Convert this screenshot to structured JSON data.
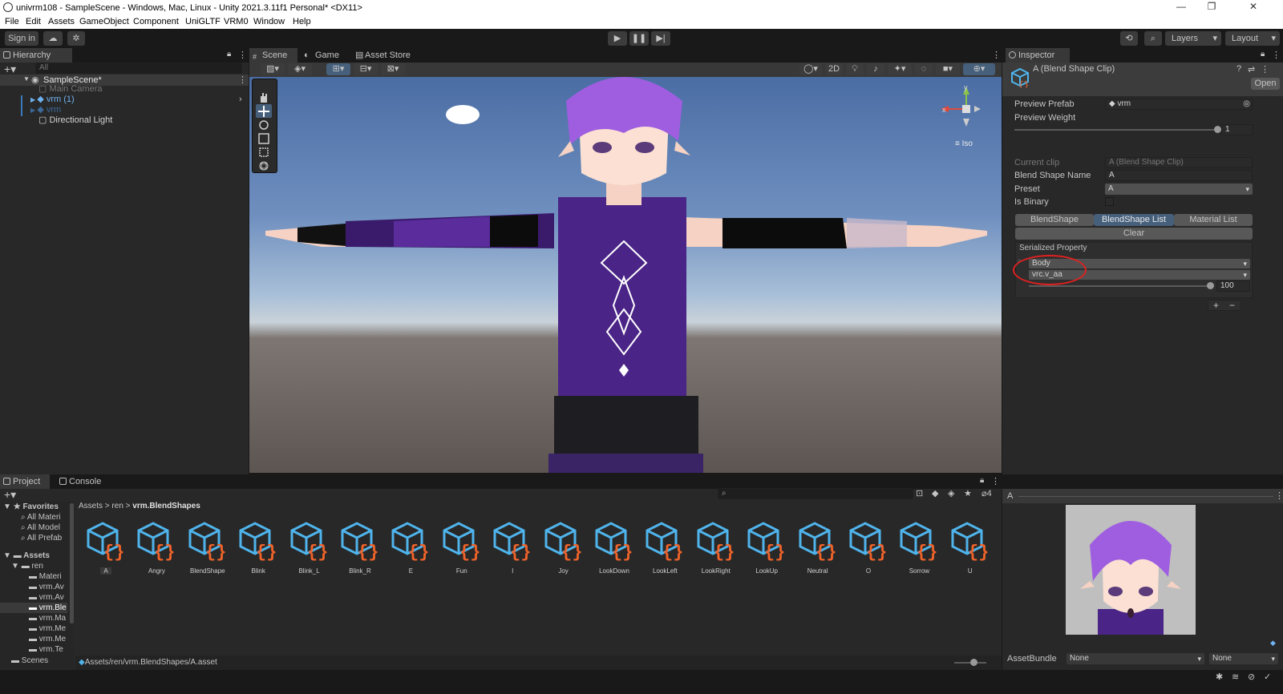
{
  "window": {
    "title": "univrm108 - SampleScene - Windows, Mac, Linux - Unity 2021.3.11f1 Personal* <DX11>"
  },
  "menu": [
    "File",
    "Edit",
    "Assets",
    "GameObject",
    "Component",
    "UniGLTF",
    "VRM0",
    "Window",
    "Help"
  ],
  "toolbar": {
    "sign_in": "Sign in",
    "layers": "Layers",
    "layout": "Layout"
  },
  "hierarchy": {
    "tab": "Hierarchy",
    "search_placeholder": "All",
    "scene": "SampleScene*",
    "items": [
      "Main Camera",
      "vrm (1)",
      "vrm",
      "Directional Light"
    ]
  },
  "scene_view": {
    "tabs": [
      "Scene",
      "Game",
      "Asset Store"
    ],
    "btn_2d": "2D",
    "gizmo_x": "x",
    "gizmo_y": "y",
    "gizmo_label": "Iso"
  },
  "inspector": {
    "tab": "Inspector",
    "object_title": "A (Blend Shape Clip)",
    "open_label": "Open",
    "preview_prefab_label": "Preview Prefab",
    "preview_prefab_value": "vrm",
    "preview_weight_label": "Preview Weight",
    "preview_weight_value": "1",
    "current_clip_label": "Current clip",
    "current_clip_value": "A (Blend Shape Clip)",
    "blend_shape_name_label": "Blend Shape Name",
    "blend_shape_name_value": "A",
    "preset_label": "Preset",
    "preset_value": "A",
    "is_binary_label": "Is Binary",
    "is_binary_checked": false,
    "tabs": [
      "BlendShape",
      "BlendShape List",
      "Material List"
    ],
    "active_tab": "BlendShape List",
    "clear_label": "Clear",
    "serialized_property_label": "Serialized Property",
    "mesh_value": "Body",
    "blendshape_value": "vrc.v_aa",
    "weight_value": "100",
    "plus": "+",
    "minus": "−",
    "preview_title": "A",
    "assetbundle_label": "AssetBundle",
    "assetbundle_value": "None",
    "assetbundle_variant": "None"
  },
  "project": {
    "tabs": [
      "Project",
      "Console"
    ],
    "breadcrumb": [
      "Assets",
      "ren",
      "vrm.BlendShapes"
    ],
    "hidden_count": "4",
    "favorites_label": "Favorites",
    "favorites": [
      "All Materi",
      "All Model",
      "All Prefab"
    ],
    "assets_label": "Assets",
    "tree": [
      "ren",
      "Materi",
      "vrm.Av",
      "vrm.Av",
      "vrm.Ble",
      "vrm.Ma",
      "vrm.Me",
      "vrm.Me",
      "vrm.Te"
    ],
    "scenes": "Scenes",
    "assets": [
      "A",
      "Angry",
      "BlendShape",
      "Blink",
      "Blink_L",
      "Blink_R",
      "E",
      "Fun",
      "I",
      "Joy",
      "LookDown",
      "LookLeft",
      "LookRight",
      "LookUp",
      "Neutral",
      "O",
      "Sorrow",
      "U"
    ],
    "footer_path": "Assets/ren/vrm.BlendShapes/A.asset"
  },
  "colors": {
    "accent": "#3a79bb",
    "annotation": "#e02020",
    "icon_cube": "#4fb4ec",
    "icon_brace": "#f0632a"
  }
}
